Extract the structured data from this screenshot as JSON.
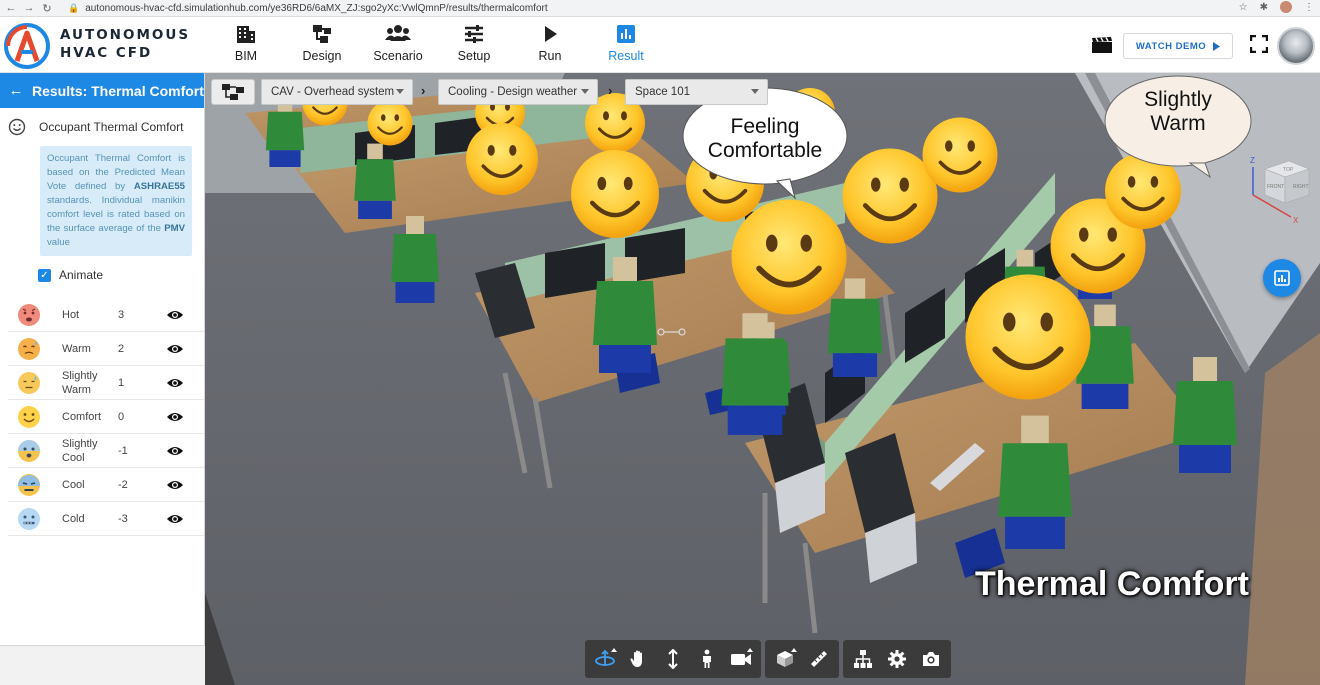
{
  "browser": {
    "url": "autonomous-hvac-cfd.simulationhub.com/ye36RD6/6aMX_ZJ:sgo2yXc:VwlQmnP/results/thermalcomfort"
  },
  "app": {
    "brand_line1": "AUTONOMOUS",
    "brand_line2": "HVAC CFD",
    "nav": [
      {
        "label": "BIM",
        "icon": "building-icon"
      },
      {
        "label": "Design",
        "icon": "diagram-icon"
      },
      {
        "label": "Scenario",
        "icon": "people-icon"
      },
      {
        "label": "Setup",
        "icon": "sliders-icon"
      },
      {
        "label": "Run",
        "icon": "play-icon"
      },
      {
        "label": "Result",
        "icon": "chart-icon",
        "active": true
      }
    ],
    "watch_demo": "WATCH DEMO"
  },
  "sidebar": {
    "title": "Results: Thermal Comfort",
    "section_title": "Occupant Thermal Comfort",
    "info": {
      "part1": "Occupant Thermal Comfort is based on the Predicted Mean Vote defined by ",
      "strong1": "ASHRAE55",
      "part2": " standards. Individual manikin comfort level is rated based on the surface average of the ",
      "strong2": "PMV",
      "part3": " value"
    },
    "animate_label": "Animate",
    "animate_checked": true,
    "levels": [
      {
        "name": "Hot",
        "value": "3",
        "color": "#f08a7a",
        "icon": "hot-face-icon"
      },
      {
        "name": "Warm",
        "value": "2",
        "color": "#f5b04a",
        "icon": "warm-face-icon"
      },
      {
        "name": "Slightly Warm",
        "value": "1",
        "color": "#f7c95a",
        "icon": "slightly-warm-face-icon"
      },
      {
        "name": "Comfort",
        "value": "0",
        "color": "#ffd24a",
        "icon": "comfort-face-icon"
      },
      {
        "name": "Slightly Cool",
        "value": "-1",
        "color": "#a9cde8",
        "icon": "slightly-cool-face-icon"
      },
      {
        "name": "Cool",
        "value": "-2",
        "color": "#8fbde3",
        "icon": "cool-face-icon"
      },
      {
        "name": "Cold",
        "value": "-3",
        "color": "#b6d8f2",
        "icon": "cold-face-icon"
      }
    ]
  },
  "viewport": {
    "system": "CAV - Overhead system",
    "weather": "Cooling - Design weather",
    "space": "Space 101",
    "bubble1_line1": "Feeling",
    "bubble1_line2": "Comfortable",
    "bubble2_line1": "Slightly",
    "bubble2_line2": "Warm",
    "overlay_title": "Thermal Comfort",
    "cube_labels": {
      "top": "TOP",
      "front": "FRONT",
      "right": "RIGHT",
      "z": "Z",
      "x": "X"
    }
  },
  "colors": {
    "accent": "#1e88e5",
    "sidebar_header": "#1e88e5",
    "info_bg": "#d7ecf8"
  }
}
